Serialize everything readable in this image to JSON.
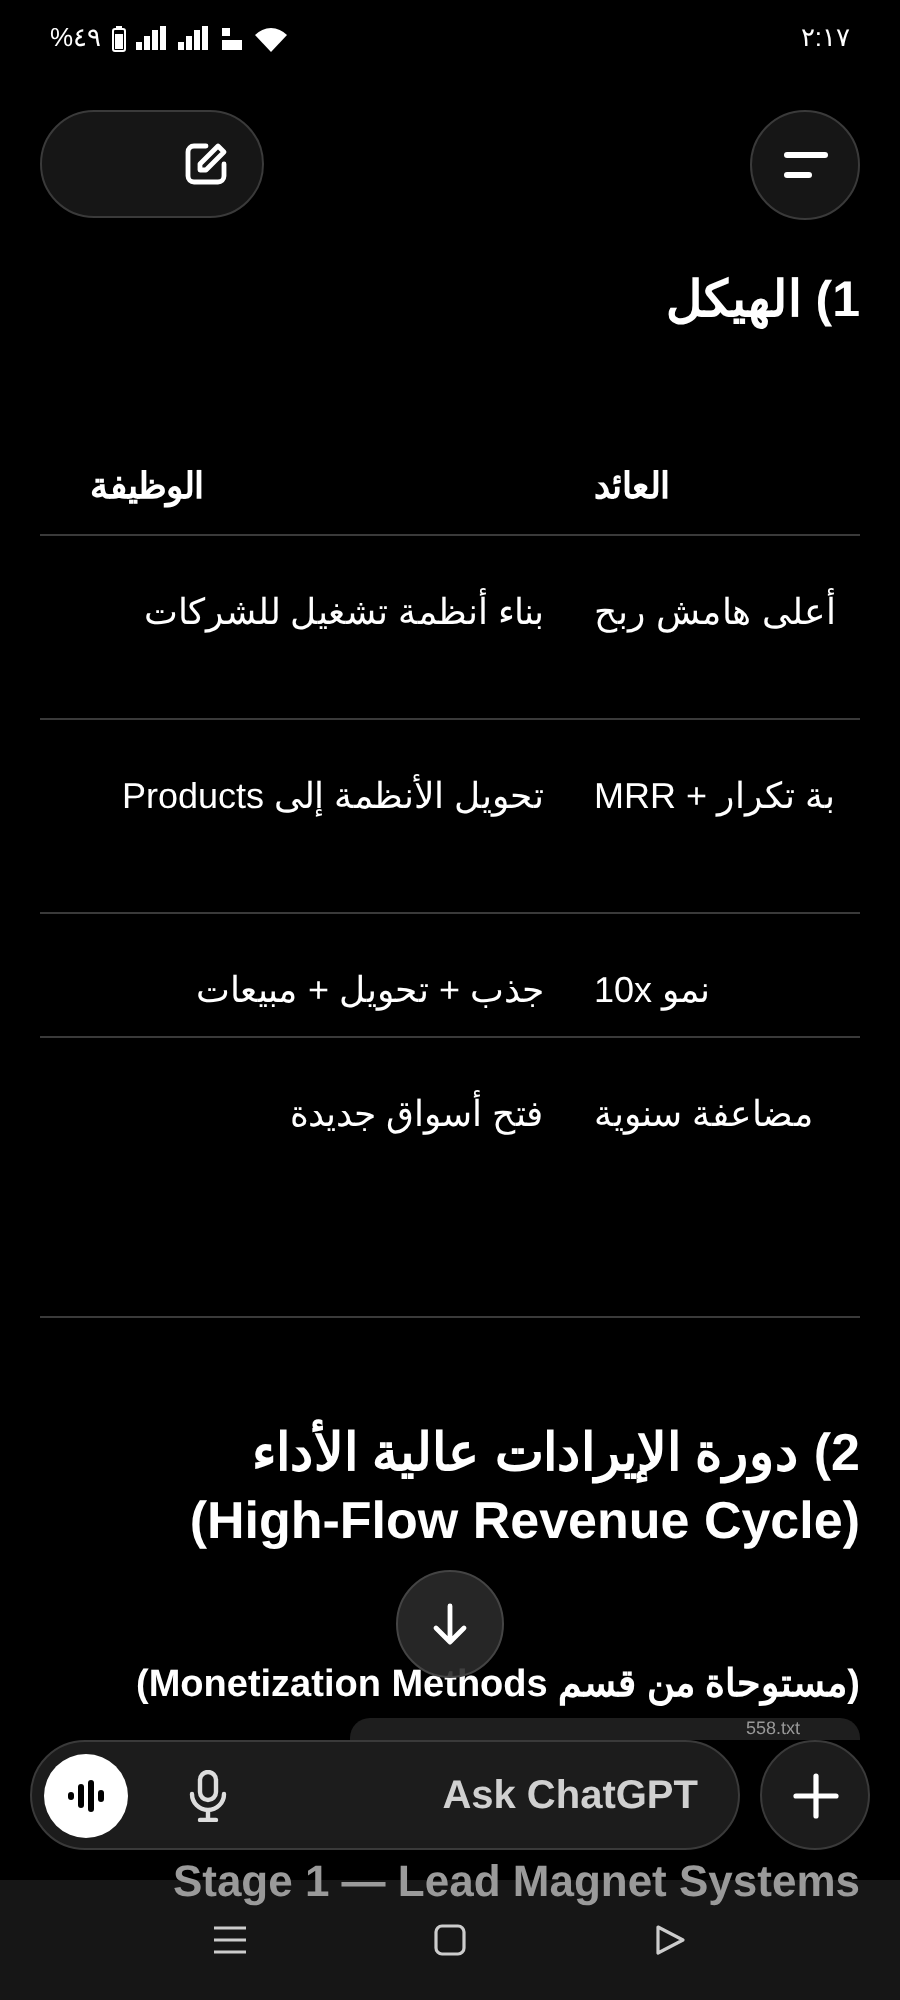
{
  "status_bar": {
    "time": "٢:١٧",
    "battery": "%٤٩"
  },
  "section_1": {
    "heading": "1) الهيكل",
    "table": {
      "columns": [
        "العائد",
        "الوظيفة"
      ],
      "rows": [
        {
          "cells": [
            "أعلى هامش ربح",
            "بناء أنظمة تشغيل للشركات"
          ]
        },
        {
          "cells": [
            "بة تكرار + MRR",
            "تحويل الأنظمة إلى Products"
          ]
        },
        {
          "cells": [
            "نمو 10x",
            "جذب + تحويل + مبيعات"
          ]
        },
        {
          "cells": [
            "مضاعفة سنوية",
            "فتح أسواق جديدة"
          ]
        }
      ]
    }
  },
  "section_2": {
    "heading_lines": [
      "2) دورة الإيرادات عالية الأداء",
      "(High-Flow Revenue Cycle)"
    ],
    "subtitle": "(مستوحاة من قسم Monetization Methods)",
    "attachment": "558.txt",
    "faded_heading": "Stage 1 — Lead Magnet Systems"
  },
  "composer": {
    "placeholder": "Ask ChatGPT"
  }
}
